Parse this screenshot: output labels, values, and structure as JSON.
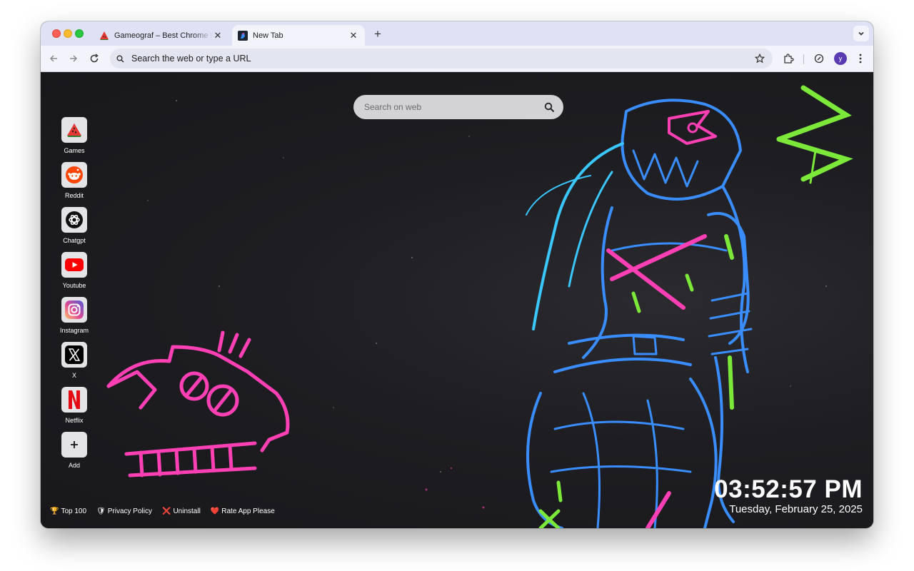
{
  "browser": {
    "tabs": [
      {
        "title": "Gameograf – Best Chrome Li",
        "active": false
      },
      {
        "title": "New Tab",
        "active": true
      }
    ],
    "omnibox_placeholder": "Search the web or type a URL",
    "profile_initial": "y"
  },
  "newtab": {
    "search_placeholder": "Search on web",
    "shortcuts": [
      {
        "label": "Games",
        "icon": "watermelon-icon"
      },
      {
        "label": "Reddit",
        "icon": "reddit-icon"
      },
      {
        "label": "Chatgpt",
        "icon": "chatgpt-icon"
      },
      {
        "label": "Youtube",
        "icon": "youtube-icon"
      },
      {
        "label": "Instagram",
        "icon": "instagram-icon"
      },
      {
        "label": "X",
        "icon": "x-icon"
      },
      {
        "label": "Netflix",
        "icon": "netflix-icon"
      },
      {
        "label": "Add",
        "icon": "plus-icon"
      }
    ],
    "footer": [
      {
        "emoji": "🏆",
        "label": "Top 100"
      },
      {
        "emoji": "🛡",
        "label": "Privacy Policy"
      },
      {
        "emoji": "❌",
        "label": "Uninstall"
      },
      {
        "emoji": "❤️",
        "label": "Rate App Please"
      }
    ],
    "clock": {
      "time": "03:52:57 PM",
      "date": "Tuesday, February 25, 2025"
    }
  },
  "colors": {
    "neon_pink": "#ff3fb4",
    "neon_blue": "#3a8dff",
    "neon_green": "#7be83a",
    "tab_strip": "#dfe1f4"
  }
}
